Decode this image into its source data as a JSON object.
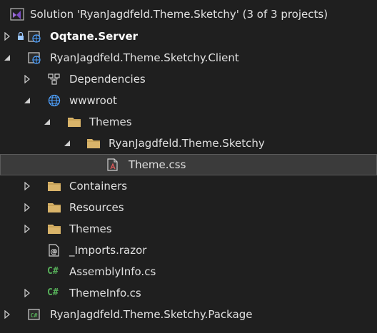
{
  "solution": {
    "label": "Solution 'RyanJagdfeld.Theme.Sketchy' (3 of 3 projects)",
    "icon": "visual-studio-solution-icon"
  },
  "projects": {
    "server": {
      "label": "Oqtane.Server",
      "icon": "web-project-icon",
      "locked": true
    },
    "client": {
      "label": "RyanJagdfeld.Theme.Sketchy.Client",
      "icon": "web-project-icon"
    },
    "package": {
      "label": "RyanJagdfeld.Theme.Sketchy.Package",
      "icon": "csharp-project-icon"
    }
  },
  "client_items": {
    "dependencies": "Dependencies",
    "wwwroot": "wwwroot",
    "themes_folder": "Themes",
    "sketchy_folder": "RyanJagdfeld.Theme.Sketchy",
    "theme_css": "Theme.css",
    "containers": "Containers",
    "resources": "Resources",
    "themes": "Themes",
    "imports": "_Imports.razor",
    "assembly_info": "AssemblyInfo.cs",
    "theme_info": "ThemeInfo.cs"
  },
  "glyphs": {
    "csharp": "C#",
    "razor": "@"
  },
  "colors": {
    "background": "#1f1f1f",
    "folder": "#d9b46a",
    "csharp": "#57b05a",
    "globe": "#4ea1ff",
    "selected_row": "#3b3b3b"
  }
}
